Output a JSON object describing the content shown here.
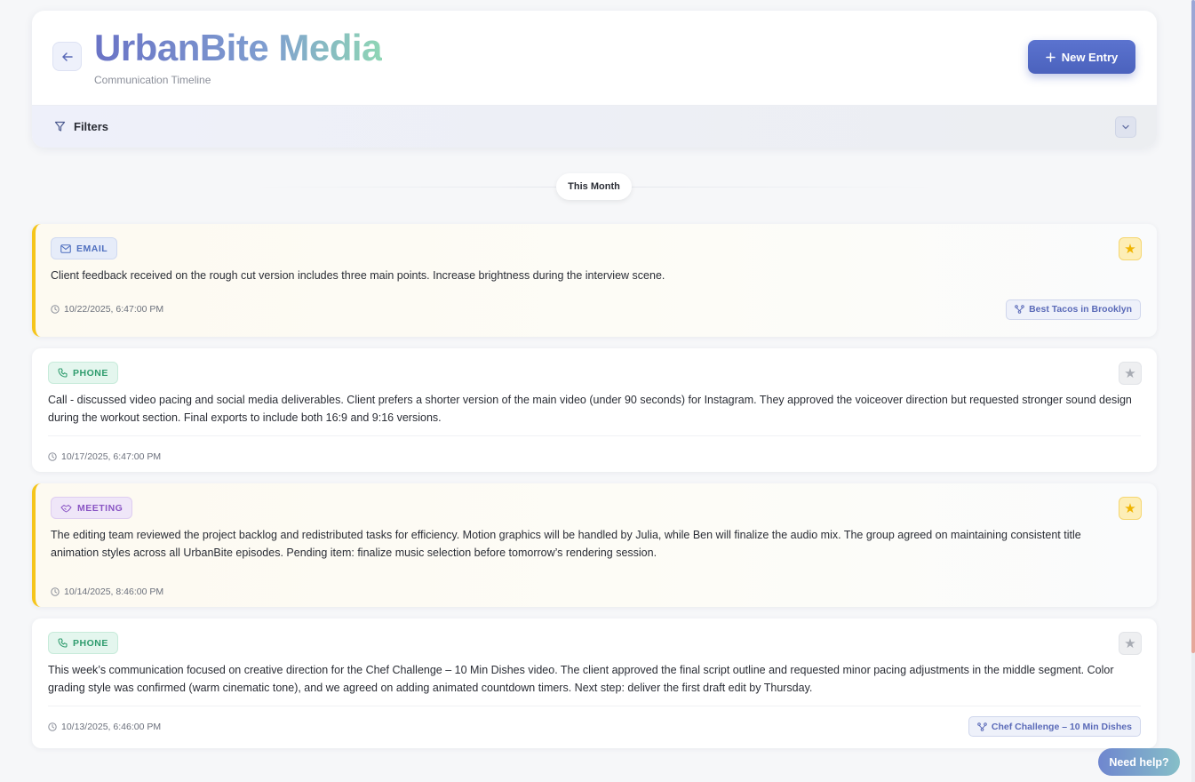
{
  "header": {
    "title": "UrbanBite Media",
    "subtitle": "Communication Timeline",
    "new_entry_label": "New Entry",
    "new_entry_icon": "plus-icon",
    "back_icon": "arrow-left-icon"
  },
  "filters": {
    "label": "Filters",
    "icon": "filter-icon",
    "toggle_icon": "chevron-down-icon"
  },
  "timeline": {
    "group_label": "This Month"
  },
  "entries": [
    {
      "type": "EMAIL",
      "type_icon": "mail-icon",
      "starred": true,
      "text": "Client feedback received on the rough cut version includes three main points. Increase brightness during the interview scene.",
      "timestamp": "10/22/2025, 6:47:00 PM",
      "project": "Best Tacos in Brooklyn"
    },
    {
      "type": "PHONE",
      "type_icon": "phone-icon",
      "starred": false,
      "text": "Call - discussed video pacing and social media deliverables. Client prefers a shorter version of the main video (under 90 seconds) for Instagram. They approved the voiceover direction but requested stronger sound design during the workout section. Final exports to include both 16:9 and 9:16 versions.",
      "timestamp": "10/17/2025, 6:47:00 PM",
      "project": ""
    },
    {
      "type": "MEETING",
      "type_icon": "meeting-icon",
      "starred": true,
      "text": "The editing team reviewed the project backlog and redistributed tasks for efficiency. Motion graphics will be handled by Julia, while Ben will finalize the audio mix. The group agreed on maintaining consistent title animation styles across all UrbanBite episodes. Pending item: finalize music selection before tomorrow’s rendering session.",
      "timestamp": "10/14/2025, 8:46:00 PM",
      "project": ""
    },
    {
      "type": "PHONE",
      "type_icon": "phone-icon",
      "starred": false,
      "text": "This week’s communication focused on creative direction for the Chef Challenge – 10 Min Dishes video. The client approved the final script outline and requested minor pacing adjustments in the middle segment. Color grading style was confirmed (warm cinematic tone), and we agreed on adding animated countdown timers. Next step: deliver the first draft edit by Thursday.",
      "timestamp": "10/13/2025, 6:46:00 PM",
      "project": "Chef Challenge – 10 Min Dishes"
    }
  ],
  "help": {
    "label": "Need help?"
  },
  "colors": {
    "accent": "#4b62bd",
    "star": "#f5c51c",
    "email": "#4f6fbf",
    "phone": "#2f9c6e",
    "meeting": "#8a55c4"
  }
}
